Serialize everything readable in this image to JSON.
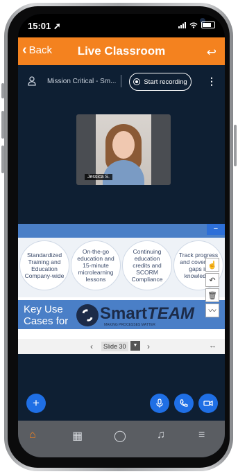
{
  "status": {
    "time": "15:01 ➚"
  },
  "header": {
    "back_label": "Back",
    "title": "Live Classroom",
    "back_icon": "chevron-left-icon",
    "rotate_icon": "rotate-icon"
  },
  "session": {
    "name": "Mission Critical - Sm...",
    "record_label": "Start recording",
    "more_icon": "kebab-icon"
  },
  "video": {
    "participant_name": "Jessica S."
  },
  "slide": {
    "circles": [
      "Standardized Training and Education Company-wide",
      "On-the-go education and 15-minute microlearning lessons",
      "Continuing education credits and SCORM Compliance",
      "Track progress and cover any gaps in knowledge"
    ],
    "key_text_line1": "Key Use",
    "key_text_line2": "Cases for",
    "logo_text_a": "Smart",
    "logo_text_b": "TEAM",
    "logo_tagline": "MAKING PROCESSES MATTER",
    "minimize_label": "−",
    "nav_label": "Slide 30"
  },
  "tools": [
    "hand-icon",
    "undo-icon",
    "trash-icon",
    "chart-icon"
  ],
  "colors": {
    "accent": "#f4821f",
    "background": "#0e1f33",
    "fab": "#1f6fe5",
    "tabbar": "#5a5d62"
  },
  "tabs": [
    "home-icon",
    "calendar-icon",
    "chat-icon",
    "bell-icon",
    "menu-icon"
  ]
}
